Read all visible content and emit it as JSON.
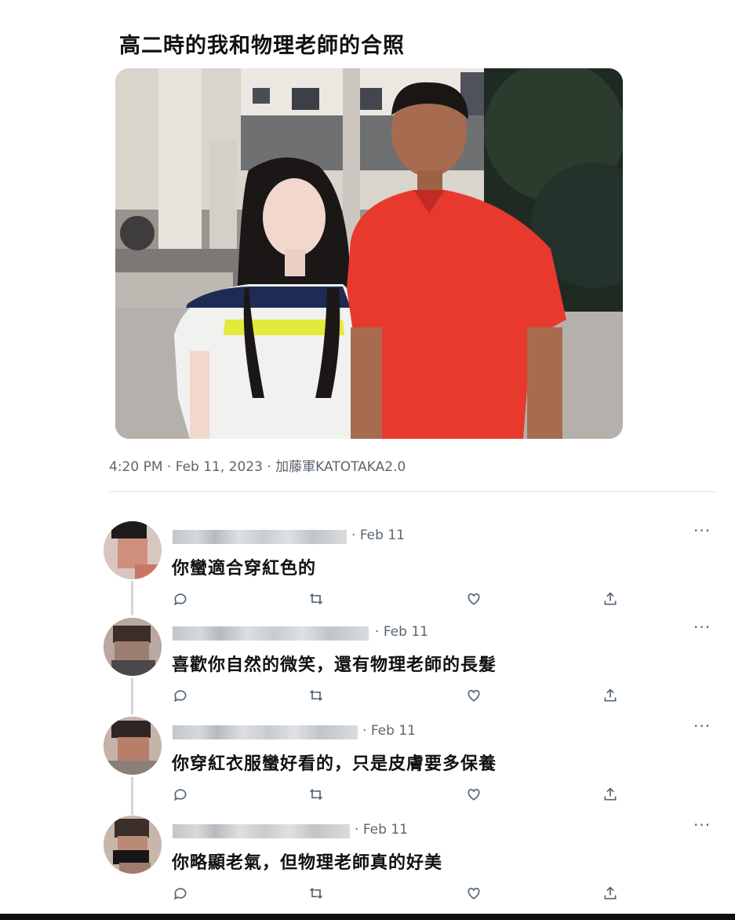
{
  "tweet": {
    "text": "高二時的我和物理老師的合照",
    "time": "4:20 PM",
    "date": "Feb 11, 2023",
    "source": "加藤軍KATOTAKA2.0"
  },
  "replies": [
    {
      "date": "Feb 11",
      "date_prefix": "·",
      "text": "你蠻適合穿紅色的"
    },
    {
      "date": "Feb 11",
      "date_prefix": "·",
      "text": "喜歡你自然的微笑，還有物理老師的長髮"
    },
    {
      "date": "Feb 11",
      "date_prefix": "·",
      "text": "你穿紅衣服蠻好看的，只是皮膚要多保養"
    },
    {
      "date": "Feb 11",
      "date_prefix": "·",
      "text": "你略顯老氣，但物理老師真的好美"
    }
  ],
  "icons": {
    "more": "more-icon",
    "reply": "reply-icon",
    "retweet": "retweet-icon",
    "like": "heart-icon",
    "share": "share-icon"
  },
  "colors": {
    "muted_text": "#5b6670",
    "thread_line": "#cfd6dc",
    "shirt_red": "#e8392f"
  }
}
